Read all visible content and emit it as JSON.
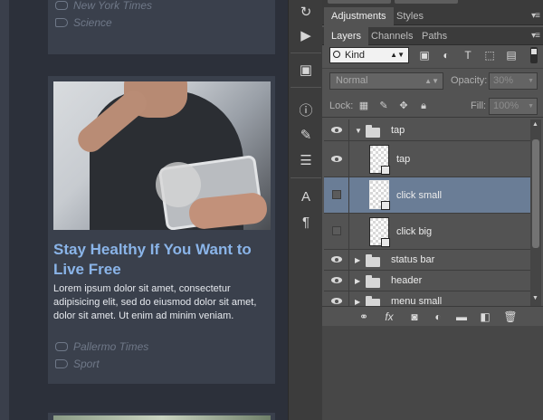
{
  "feed": {
    "top_card": {
      "source": "New York Times",
      "category": "Science"
    },
    "card": {
      "title": "Stay Healthy If You Want to Live Free",
      "body": "Lorem ipsum dolor sit amet, consectetur adipisicing elit, sed do eiusmod dolor sit amet, dolor sit amet. Ut enim ad minim veniam.",
      "source": "Pallermo Times",
      "category": "Sport"
    }
  },
  "toolbar": {
    "tools": [
      "history-icon",
      "play-icon",
      "3d-cube-icon",
      "info-icon",
      "brush-presets-icon",
      "properties-sliders-icon",
      "character-icon",
      "paragraph-icon"
    ]
  },
  "panel_top_tabs": {
    "adjustments": "Adjustments",
    "styles": "Styles"
  },
  "layers_tabs": {
    "layers": "Layers",
    "channels": "Channels",
    "paths": "Paths"
  },
  "filter": {
    "kind_label": "Kind"
  },
  "blend": {
    "mode": "Normal",
    "opacity_label": "Opacity:",
    "opacity_value": "30%",
    "fill_label": "Fill:",
    "fill_value": "100%",
    "lock_label": "Lock:"
  },
  "layers": [
    {
      "name": "tap",
      "type": "group",
      "expanded": true,
      "visible": true,
      "selected": false
    },
    {
      "name": "tap",
      "type": "smart",
      "visible": true,
      "selected": false
    },
    {
      "name": "click small",
      "type": "smart",
      "visible": false,
      "selected": true
    },
    {
      "name": "click big",
      "type": "smart",
      "visible": false,
      "selected": false
    },
    {
      "name": "status bar",
      "type": "group",
      "expanded": false,
      "visible": true,
      "selected": false
    },
    {
      "name": "header",
      "type": "group",
      "expanded": false,
      "visible": true,
      "selected": false
    },
    {
      "name": "menu small",
      "type": "group",
      "expanded": false,
      "visible": true,
      "selected": false
    }
  ],
  "colors": {
    "accent": "#8ab4e8",
    "selected_layer": "#6a7d96",
    "panel_bg": "#535353"
  }
}
